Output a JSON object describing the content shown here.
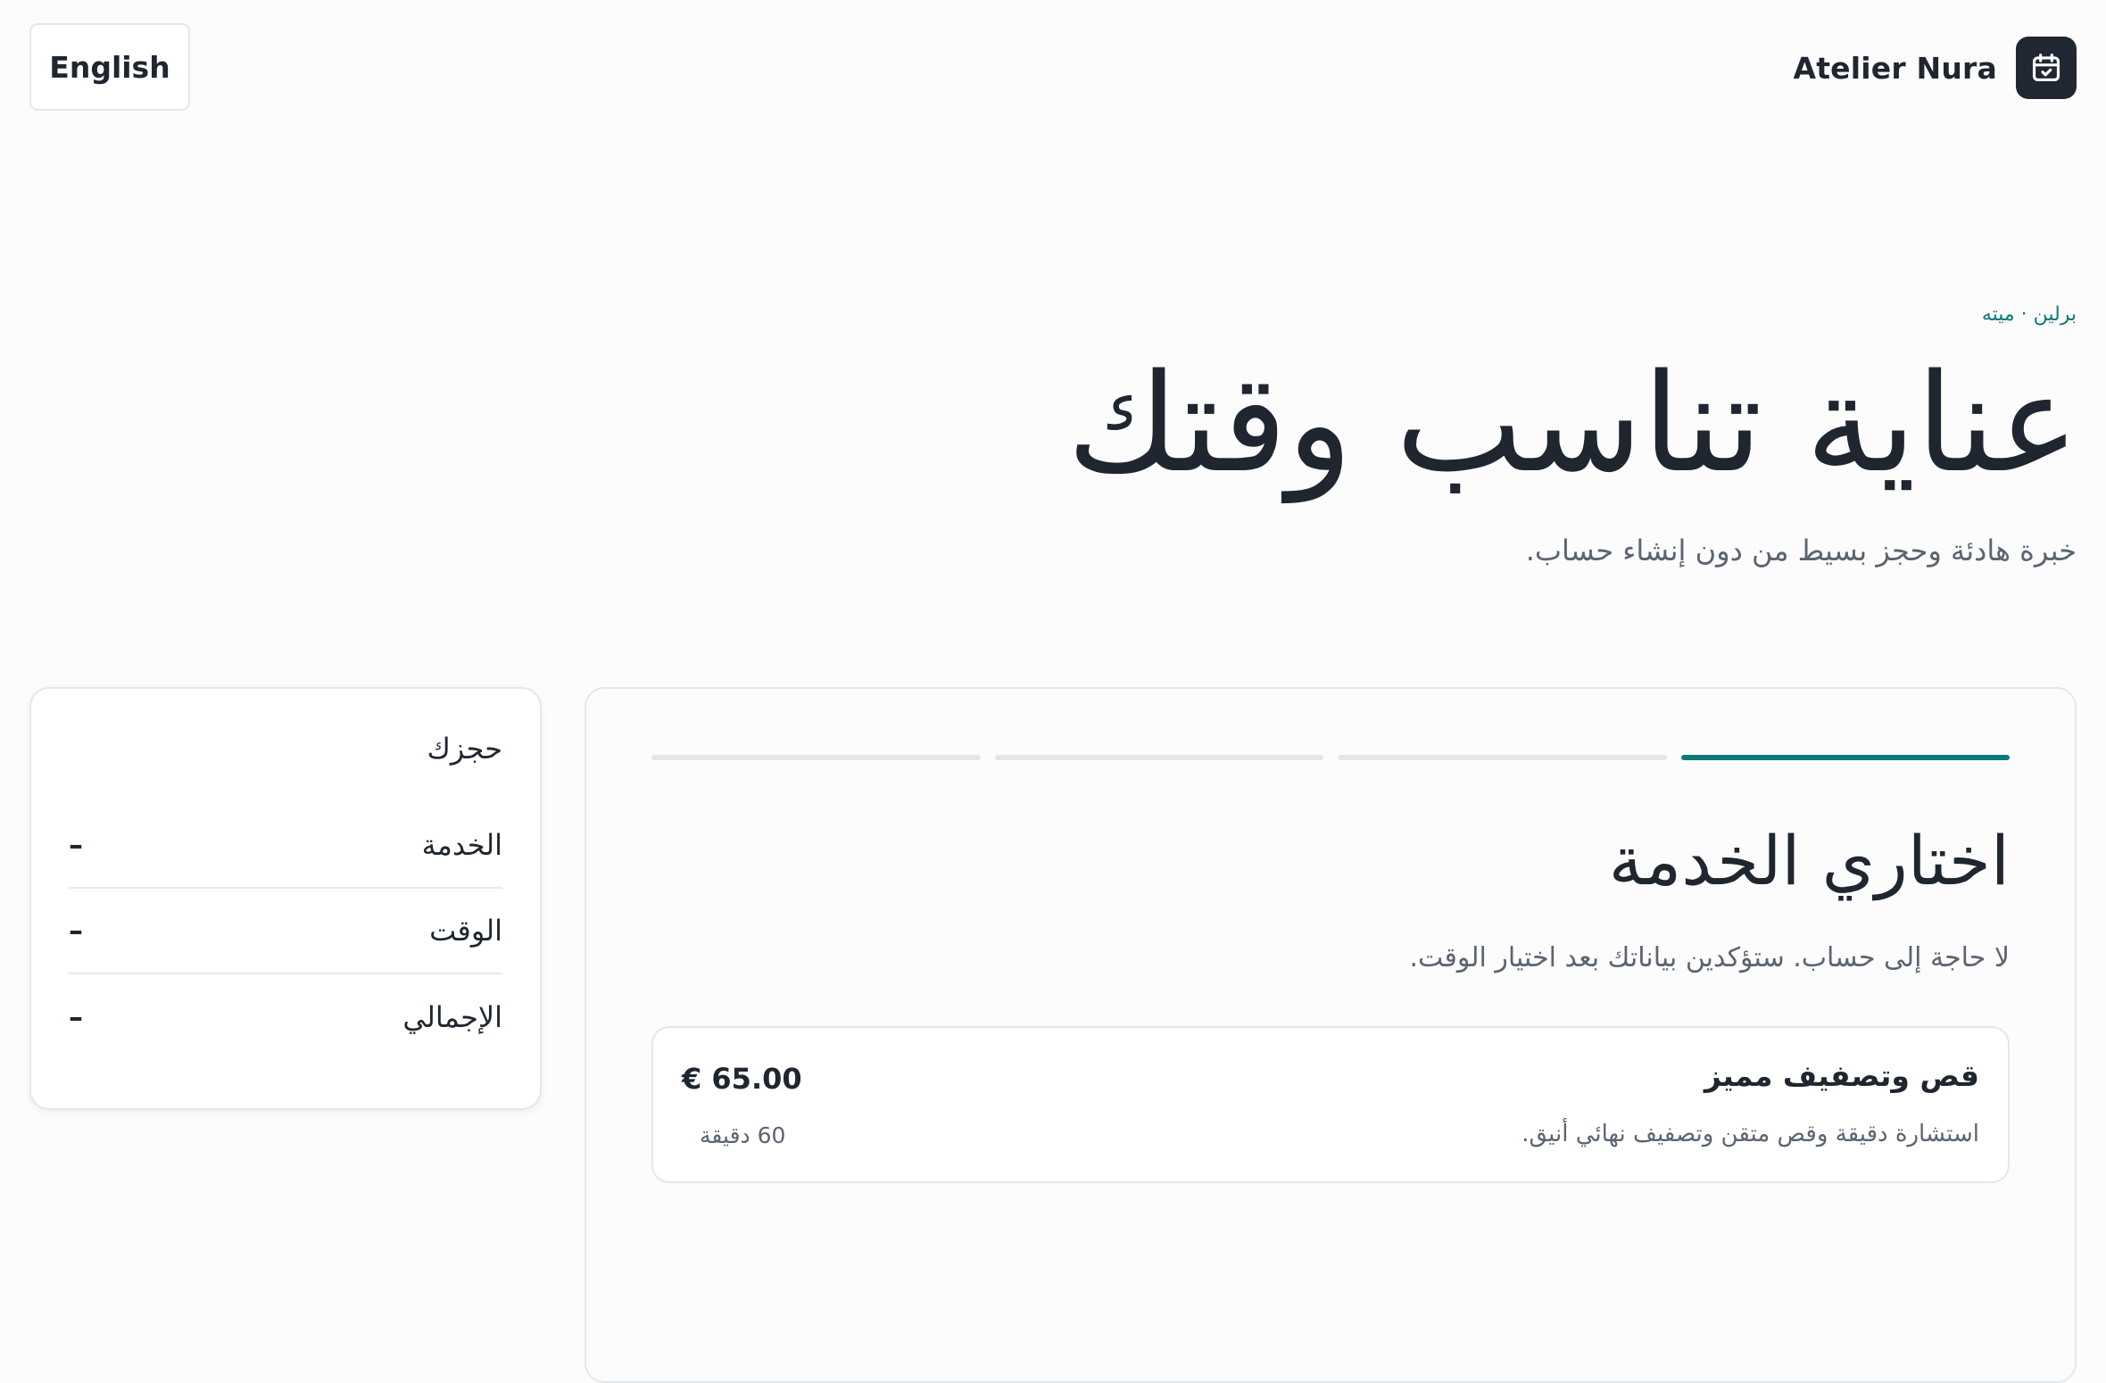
{
  "header": {
    "language_button": "English",
    "brand_name": "Atelier Nura",
    "brand_icon": "calendar-check-icon"
  },
  "hero": {
    "eyebrow": "برلين · ميته",
    "title": "عناية تناسب وقتك",
    "subtitle": "خبرة هادئة وحجز بسيط من دون إنشاء حساب."
  },
  "summary": {
    "title": "حجزك",
    "rows": [
      {
        "label": "الخدمة",
        "value": "–"
      },
      {
        "label": "الوقت",
        "value": "–"
      },
      {
        "label": "الإجمالي",
        "value": "–"
      }
    ]
  },
  "booking": {
    "steps_total": 4,
    "current_step": 1,
    "accent_color": "#0e7a78",
    "title": "اختاري الخدمة",
    "subtitle": "لا حاجة إلى حساب. ستؤكدين بياناتك بعد اختيار الوقت.",
    "services": [
      {
        "name": "قص وتصفيف مميز",
        "description": "استشارة دقيقة وقص متقن وتصفيف نهائي أنيق.",
        "price": "€ 65.00",
        "duration": "60 دقيقة"
      }
    ]
  }
}
